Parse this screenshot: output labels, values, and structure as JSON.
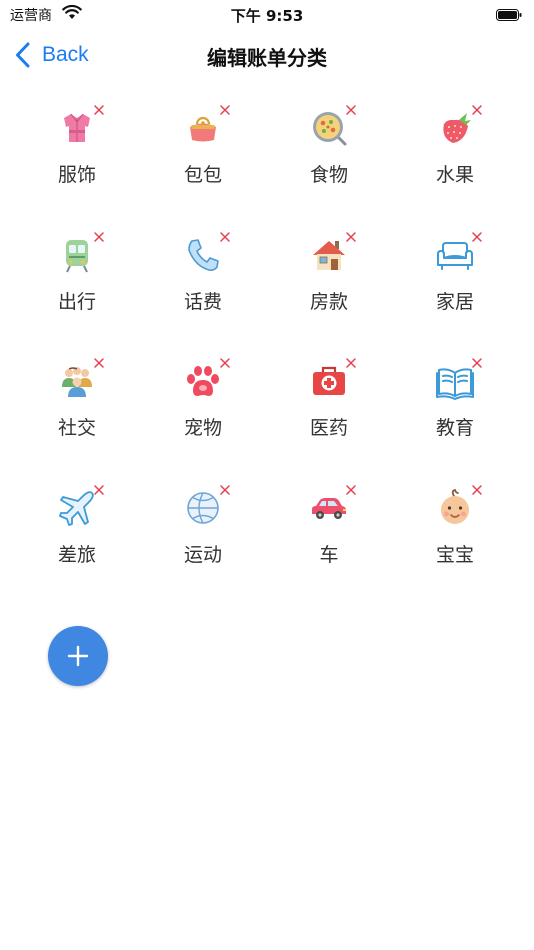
{
  "status_bar": {
    "carrier": "运营商",
    "time": "下午 9:53"
  },
  "nav": {
    "back_label": "Back",
    "title": "编辑账单分类"
  },
  "categories": [
    {
      "label": "服饰",
      "icon": "clothing-icon"
    },
    {
      "label": "包包",
      "icon": "purse-icon"
    },
    {
      "label": "食物",
      "icon": "food-plate-icon"
    },
    {
      "label": "水果",
      "icon": "strawberry-icon"
    },
    {
      "label": "出行",
      "icon": "train-icon"
    },
    {
      "label": "话费",
      "icon": "phone-icon"
    },
    {
      "label": "房款",
      "icon": "house-icon"
    },
    {
      "label": "家居",
      "icon": "sofa-icon"
    },
    {
      "label": "社交",
      "icon": "people-icon"
    },
    {
      "label": "宠物",
      "icon": "paw-icon"
    },
    {
      "label": "医药",
      "icon": "first-aid-icon"
    },
    {
      "label": "教育",
      "icon": "book-icon"
    },
    {
      "label": "差旅",
      "icon": "airplane-icon"
    },
    {
      "label": "运动",
      "icon": "ball-icon"
    },
    {
      "label": "车",
      "icon": "car-icon"
    },
    {
      "label": "宝宝",
      "icon": "baby-icon"
    }
  ],
  "colors": {
    "accent": "#1d7cf2",
    "fab": "#3f87e0",
    "delete": "#e5404f"
  },
  "fab": {
    "icon": "plus-icon"
  }
}
